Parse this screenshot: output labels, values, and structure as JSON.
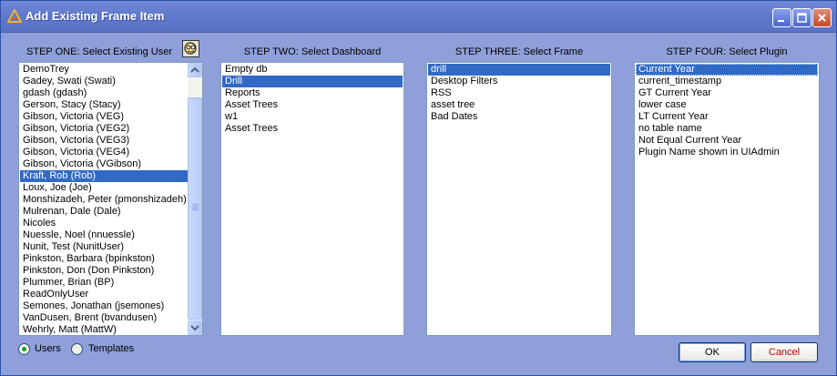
{
  "window": {
    "title": "Add Existing Frame Item"
  },
  "steps": {
    "one": {
      "label": "STEP ONE: Select Existing User",
      "items": [
        "DemoTrey",
        "Gadey, Swati (Swati)",
        "gdash (gdash)",
        "Gerson, Stacy (Stacy)",
        "Gibson, Victoria (VEG)",
        "Gibson, Victoria (VEG2)",
        "Gibson, Victoria (VEG3)",
        "Gibson, Victoria (VEG4)",
        "Gibson, Victoria (VGibson)",
        "Kraft, Rob (Rob)",
        "Loux, Joe (Joe)",
        "Monshizadeh, Peter (pmonshizadeh)",
        "Mulrenan, Dale (Dale)",
        "Nicoles",
        "Nuessle, Noel (nnuessle)",
        "Nunit, Test (NunitUser)",
        "Pinkston, Barbara (bpinkston)",
        "Pinkston, Don (Don Pinkston)",
        "Plummer, Brian (BP)",
        "ReadOnlyUser",
        "Semones, Jonathan (jsemones)",
        "VanDusen, Brent (bvandusen)",
        "Wehrly, Matt (MattW)"
      ],
      "selected": "Kraft, Rob (Rob)"
    },
    "two": {
      "label": "STEP TWO: Select Dashboard",
      "items": [
        "Empty db",
        "Drill",
        "Reports",
        "Asset Trees",
        "w1",
        "Asset Trees"
      ],
      "selected": "Drill"
    },
    "three": {
      "label": "STEP THREE: Select Frame",
      "items": [
        "drill",
        "Desktop Filters",
        "RSS",
        "asset tree",
        "Bad Dates"
      ],
      "selected": "drill"
    },
    "four": {
      "label": "STEP FOUR: Select Plugin",
      "items": [
        "Current Year",
        "current_timestamp",
        "GT Current Year",
        "lower case",
        "LT Current Year",
        "no table name",
        "Not Equal Current Year",
        "Plugin Name shown in UIAdmin"
      ],
      "selected": "Current Year"
    }
  },
  "source_options": {
    "users_label": "Users",
    "templates_label": "Templates",
    "selected": "Users"
  },
  "buttons": {
    "ok_label": "OK",
    "cancel_label": "Cancel"
  },
  "icons": {
    "title": "app-icon",
    "user_lookup": "find-user-icon"
  }
}
